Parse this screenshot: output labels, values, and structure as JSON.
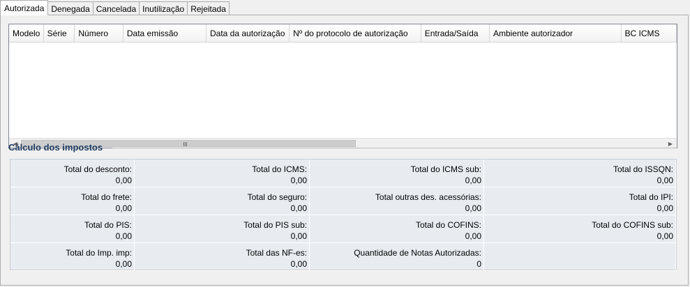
{
  "tabs": [
    {
      "label": "Autorizada",
      "active": true
    },
    {
      "label": "Denegada",
      "active": false
    },
    {
      "label": "Cancelada",
      "active": false
    },
    {
      "label": "Inutilização",
      "active": false
    },
    {
      "label": "Rejeitada",
      "active": false
    }
  ],
  "grid": {
    "columns": [
      "Modelo",
      "Série",
      "Número",
      "Data emissão",
      "Data da autorização",
      "Nº do protocolo de autorização",
      "Entrada/Saída",
      "Ambiente autorizador",
      "BC ICMS"
    ],
    "rows": []
  },
  "section": {
    "title": "Cálculo dos impostos"
  },
  "totals": [
    {
      "label": "Total do desconto:",
      "value": "0,00"
    },
    {
      "label": "Total do ICMS:",
      "value": "0,00"
    },
    {
      "label": "Total do ICMS sub:",
      "value": "0,00"
    },
    {
      "label": "Total do ISSQN:",
      "value": "0,00"
    },
    {
      "label": "Total do frete:",
      "value": "0,00"
    },
    {
      "label": "Total do seguro:",
      "value": "0,00"
    },
    {
      "label": "Total outras des. acessórias:",
      "value": "0,00"
    },
    {
      "label": "Total do IPI:",
      "value": "0,00"
    },
    {
      "label": "Total do PIS:",
      "value": "0,00"
    },
    {
      "label": "Total do PIS sub:",
      "value": "0,00"
    },
    {
      "label": "Total do COFINS:",
      "value": "0,00"
    },
    {
      "label": "Total do COFINS sub:",
      "value": "0,00"
    },
    {
      "label": "Total do Imp. imp:",
      "value": "0,00"
    },
    {
      "label": "Total das NF-es:",
      "value": "0,00"
    },
    {
      "label": "Quantidade de Notas Autorizadas:",
      "value": "0"
    },
    {
      "label": "",
      "value": ""
    }
  ],
  "icons": {
    "scroll_left": "chevron-left-icon",
    "scroll_right": "chevron-right-icon",
    "scroll_grip": "grip-icon"
  }
}
